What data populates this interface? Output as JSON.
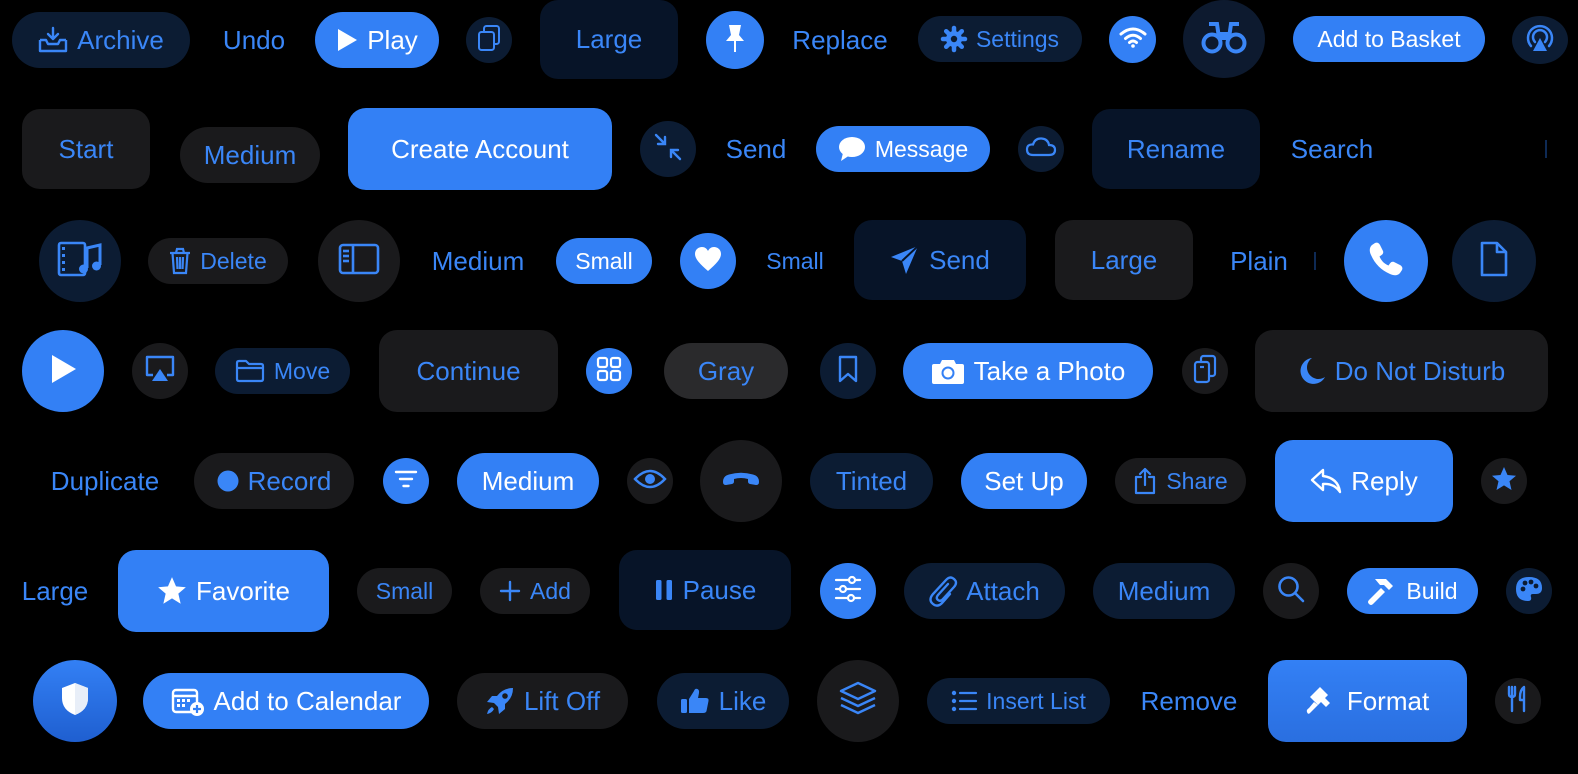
{
  "colors": {
    "accent": "#3380f5",
    "accent_text": "#3a86f7",
    "background": "#000000",
    "on_accent": "#ffffff"
  },
  "buttons": {
    "archive": "Archive",
    "undo": "Undo",
    "play": "Play",
    "large_1": "Large",
    "replace": "Replace",
    "settings": "Settings",
    "add_to_basket": "Add to Basket",
    "start": "Start",
    "medium_1": "Medium",
    "create_account": "Create Account",
    "send_1": "Send",
    "message": "Message",
    "rename": "Rename",
    "search": "Search",
    "delete": "Delete",
    "medium_2": "Medium",
    "small_1": "Small",
    "small_2": "Small",
    "send_2": "Send",
    "large_2": "Large",
    "plain": "Plain",
    "move": "Move",
    "continue": "Continue",
    "gray": "Gray",
    "take_a_photo": "Take a Photo",
    "do_not_disturb": "Do Not Disturb",
    "duplicate": "Duplicate",
    "record": "Record",
    "medium_3": "Medium",
    "tinted": "Tinted",
    "set_up": "Set Up",
    "share": "Share",
    "reply": "Reply",
    "large_3": "Large",
    "favorite": "Favorite",
    "small_3": "Small",
    "add": "Add",
    "pause": "Pause",
    "attach": "Attach",
    "medium_4": "Medium",
    "build": "Build",
    "add_to_calendar": "Add to Calendar",
    "lift_off": "Lift Off",
    "like": "Like",
    "insert_list": "Insert List",
    "remove": "Remove",
    "format": "Format"
  }
}
